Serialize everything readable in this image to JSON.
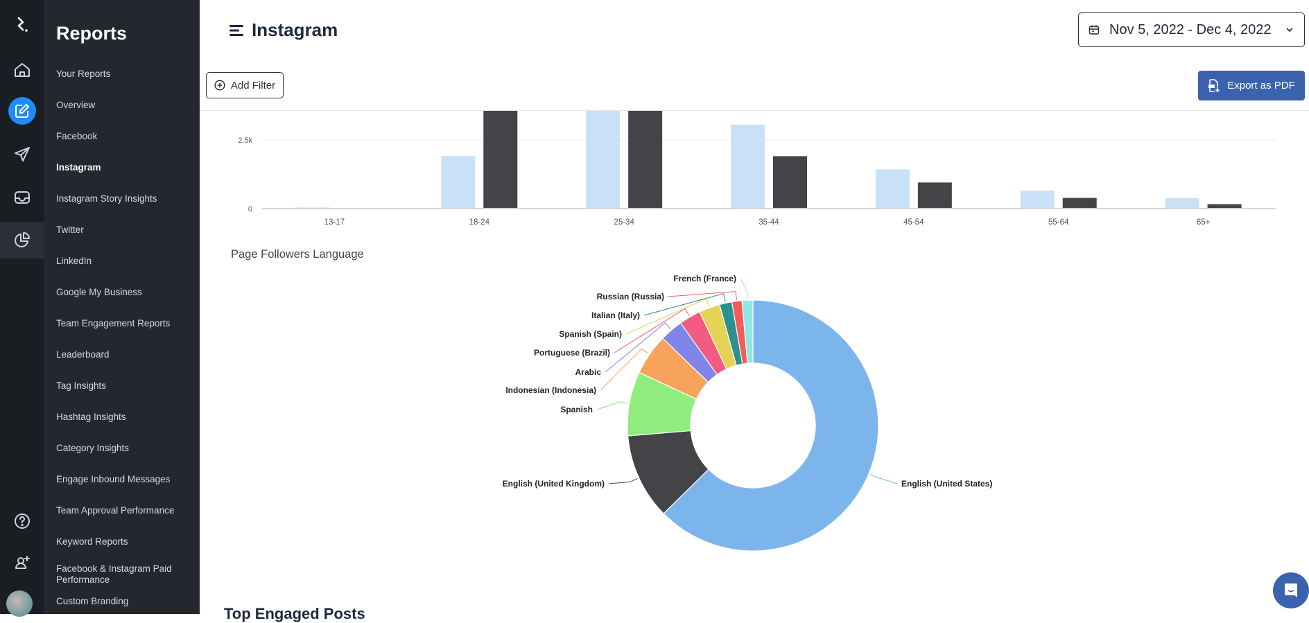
{
  "rail": {
    "icons": [
      "logo-icon",
      "home-icon",
      "compose-icon",
      "send-icon",
      "inbox-icon",
      "reports-icon",
      "help-icon",
      "add-user-icon",
      "avatar"
    ]
  },
  "sidebar": {
    "title": "Reports",
    "items": [
      {
        "label": "Your Reports"
      },
      {
        "label": "Overview"
      },
      {
        "label": "Facebook"
      },
      {
        "label": "Instagram",
        "active": true
      },
      {
        "label": "Instagram Story Insights"
      },
      {
        "label": "Twitter"
      },
      {
        "label": "LinkedIn"
      },
      {
        "label": "Google My Business"
      },
      {
        "label": "Team Engagement Reports"
      },
      {
        "label": "Leaderboard"
      },
      {
        "label": "Tag Insights"
      },
      {
        "label": "Hashtag Insights"
      },
      {
        "label": "Category Insights"
      },
      {
        "label": "Engage Inbound Messages"
      },
      {
        "label": "Team Approval Performance"
      },
      {
        "label": "Keyword Reports"
      },
      {
        "label": "Facebook & Instagram Paid Performance"
      },
      {
        "label": "Custom Branding"
      }
    ]
  },
  "header": {
    "title": "Instagram",
    "date_range": "Nov 5, 2022 - Dec 4, 2022",
    "add_filter": "Add Filter",
    "export": "Export as PDF"
  },
  "next_section": "Top Engaged Posts",
  "colors": {
    "accent": "#3b63ad",
    "active_rail": "#1d8cf8"
  },
  "chart_data": [
    {
      "type": "bar",
      "categories": [
        "13-17",
        "18-24",
        "25-34",
        "35-44",
        "45-54",
        "55-64",
        "65+"
      ],
      "yticks": [
        "0",
        "2.5k"
      ],
      "ylim": [
        0,
        3500
      ],
      "grid": true,
      "series": [
        {
          "color": "#c9e1f6",
          "values": [
            40,
            1910,
            4200,
            3060,
            1430,
            660,
            380
          ]
        },
        {
          "color": "#434348",
          "values": [
            20,
            4000,
            4400,
            1910,
            950,
            390,
            160
          ]
        }
      ]
    },
    {
      "type": "pie",
      "donut": true,
      "title": "Page Followers Language",
      "labels": [
        "English (United States)",
        "English (United Kingdom)",
        "Spanish",
        "Indonesian (Indonesia)",
        "Arabic",
        "Portuguese (Brazil)",
        "Spanish (Spain)",
        "Italian (Italy)",
        "Russian (Russia)",
        "French (France)"
      ],
      "values": [
        62.8,
        11.1,
        8.3,
        5.3,
        3.0,
        2.8,
        2.7,
        1.6,
        1.3,
        1.4
      ],
      "colors": [
        "#7cb5ec",
        "#434348",
        "#90ed7d",
        "#f7a35c",
        "#8085e9",
        "#f15c80",
        "#e4d354",
        "#2b908f",
        "#f45b5b",
        "#91e8e1"
      ]
    }
  ]
}
